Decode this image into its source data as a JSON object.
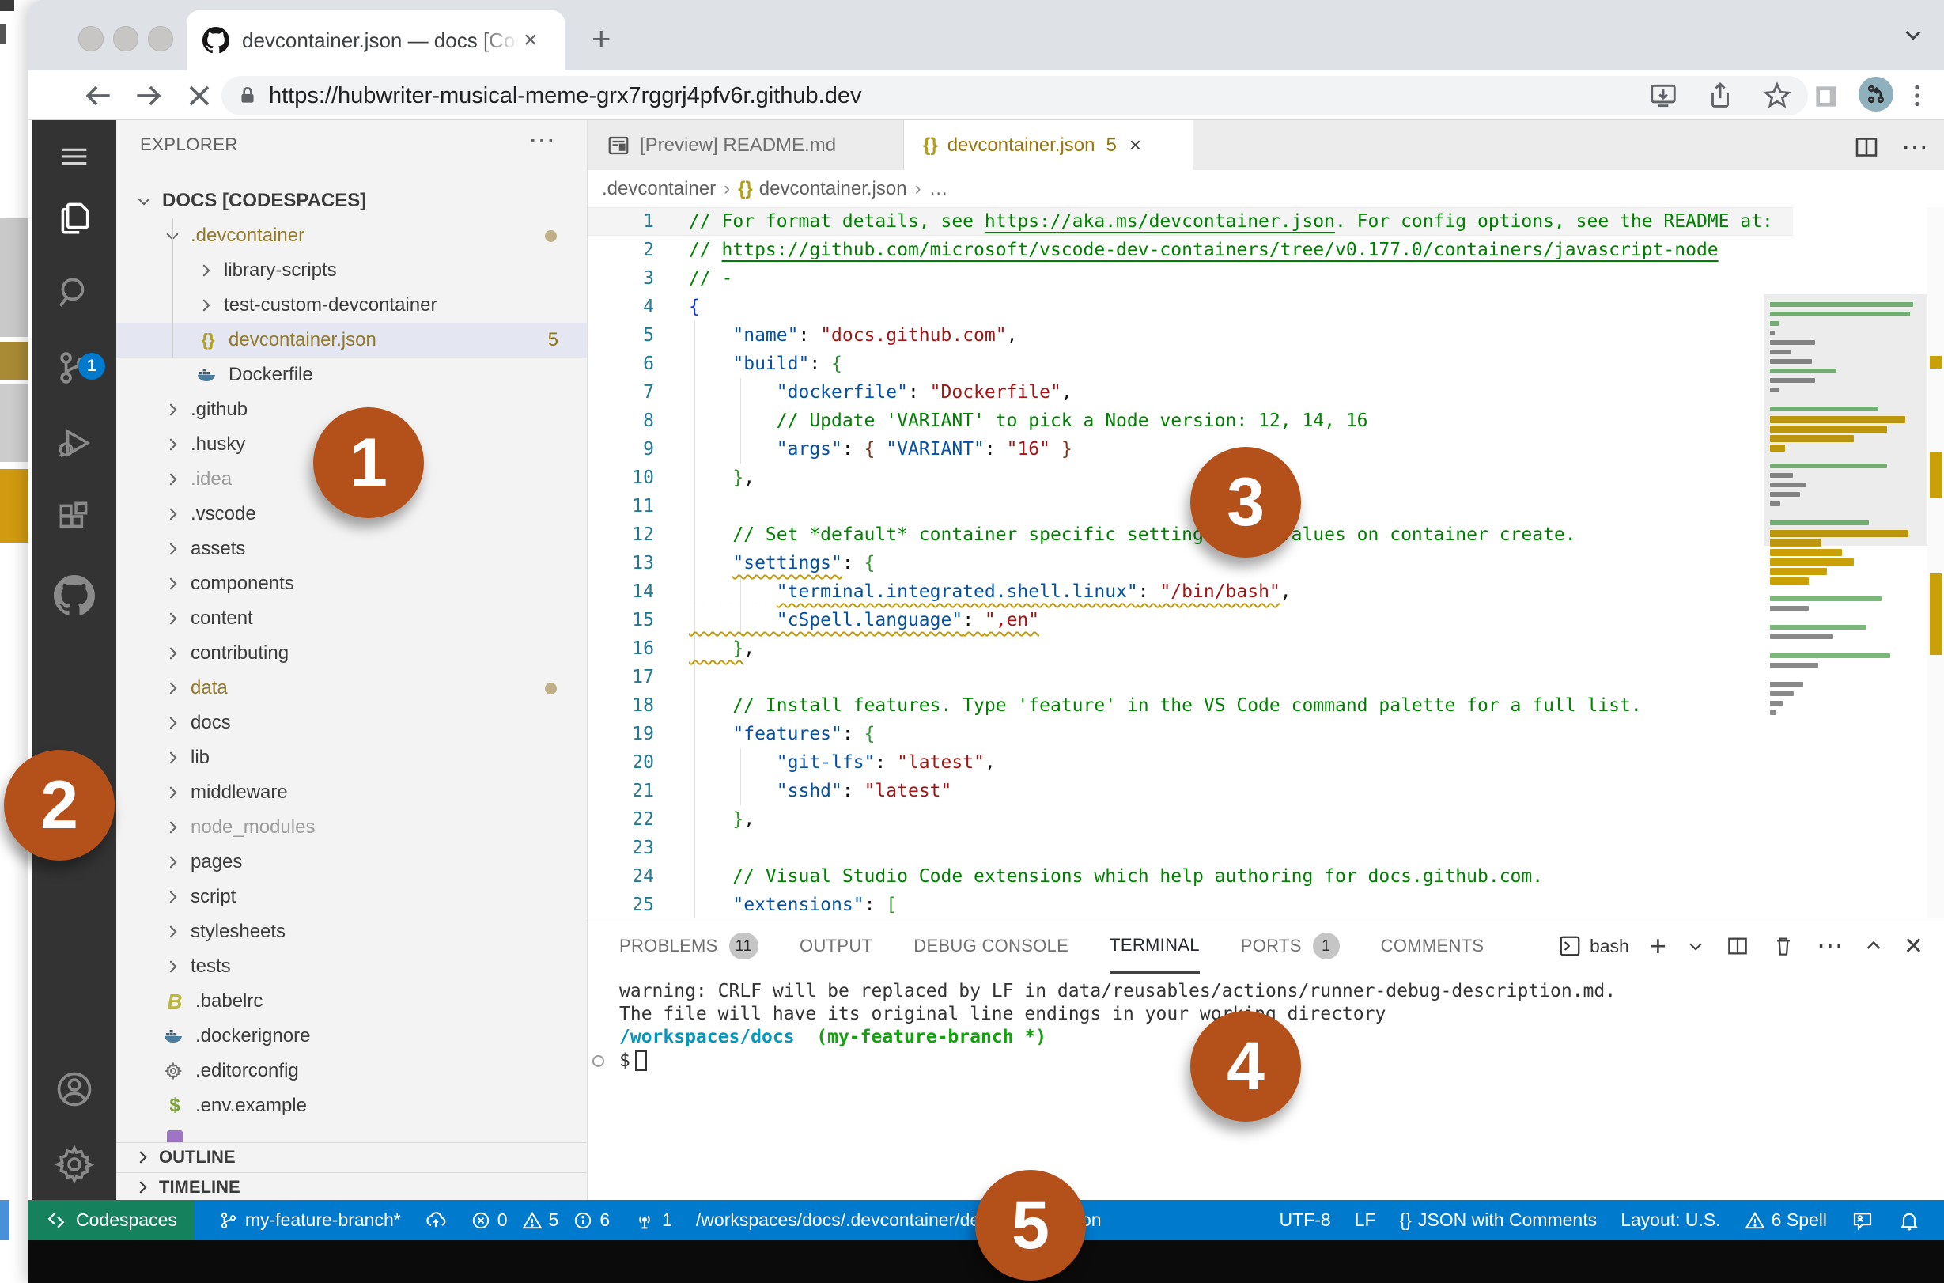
{
  "browser": {
    "tab_title": "devcontainer.json — docs [Cod",
    "tab_close": "×",
    "new_tab": "+",
    "url": "https://hubwriter-musical-meme-grx7rggrj4pfv6r.github.dev"
  },
  "activity_bar": {
    "scm_badge": "1",
    "items": [
      "menu",
      "explorer",
      "search",
      "source-control",
      "run-debug",
      "extensions",
      "github",
      "account",
      "settings"
    ]
  },
  "explorer": {
    "header": "EXPLORER",
    "header_actions": "⋯",
    "root_label": "DOCS [CODESPACES]",
    "items": [
      {
        "label": ".devcontainer",
        "depth": 1,
        "arrow": "down",
        "cls": "gold",
        "dot": true
      },
      {
        "label": "library-scripts",
        "depth": 2,
        "arrow": "right"
      },
      {
        "label": "test-custom-devcontainer",
        "depth": 2,
        "arrow": "right"
      },
      {
        "label": "devcontainer.json",
        "depth": 2,
        "icon": "json",
        "cls": "gold selected",
        "badge": "5"
      },
      {
        "label": "Dockerfile",
        "depth": 2,
        "icon": "docker"
      },
      {
        "label": ".github",
        "depth": 1,
        "arrow": "right"
      },
      {
        "label": ".husky",
        "depth": 1,
        "arrow": "right"
      },
      {
        "label": ".idea",
        "depth": 1,
        "arrow": "right",
        "cls": "ignored"
      },
      {
        "label": ".vscode",
        "depth": 1,
        "arrow": "right"
      },
      {
        "label": "assets",
        "depth": 1,
        "arrow": "right"
      },
      {
        "label": "components",
        "depth": 1,
        "arrow": "right"
      },
      {
        "label": "content",
        "depth": 1,
        "arrow": "right"
      },
      {
        "label": "contributing",
        "depth": 1,
        "arrow": "right"
      },
      {
        "label": "data",
        "depth": 1,
        "arrow": "right",
        "cls": "gold",
        "dot": true
      },
      {
        "label": "docs",
        "depth": 1,
        "arrow": "right"
      },
      {
        "label": "lib",
        "depth": 1,
        "arrow": "right"
      },
      {
        "label": "middleware",
        "depth": 1,
        "arrow": "right"
      },
      {
        "label": "node_modules",
        "depth": 1,
        "arrow": "right",
        "cls": "ignored"
      },
      {
        "label": "pages",
        "depth": 1,
        "arrow": "right"
      },
      {
        "label": "script",
        "depth": 1,
        "arrow": "right"
      },
      {
        "label": "stylesheets",
        "depth": 1,
        "arrow": "right"
      },
      {
        "label": "tests",
        "depth": 1,
        "arrow": "right"
      },
      {
        "label": ".babelrc",
        "depth": 1,
        "icon": "babel"
      },
      {
        "label": ".dockerignore",
        "depth": 1,
        "icon": "docker"
      },
      {
        "label": ".editorconfig",
        "depth": 1,
        "icon": "gear"
      },
      {
        "label": ".env.example",
        "depth": 1,
        "icon": "dollar"
      },
      {
        "label": "",
        "depth": 1,
        "icon": "purple"
      }
    ],
    "outline_label": "OUTLINE",
    "timeline_label": "TIMELINE"
  },
  "editor": {
    "tabs": [
      {
        "label": "[Preview] README.md",
        "active": false
      },
      {
        "label": "devcontainer.json",
        "badge": "5",
        "close": "×",
        "active": true
      }
    ],
    "breadcrumb": {
      "a": ".devcontainer",
      "b": "devcontainer.json",
      "c": "…",
      "json_icon": "{}"
    },
    "lines": [
      [
        {
          "c": "com",
          "t": "// For format details, see "
        },
        {
          "c": "com lnk",
          "t": "https://aka.ms/devcontainer.json"
        },
        {
          "c": "com",
          "t": ". For config options, see the README at:"
        }
      ],
      [
        {
          "c": "com",
          "t": "// "
        },
        {
          "c": "com lnk",
          "t": "https://github.com/microsoft/vscode-dev-containers/tree/v0.177.0/containers/javascript-node"
        }
      ],
      [
        {
          "c": "com",
          "t": "// -"
        }
      ],
      [
        {
          "c": "b1",
          "t": "{"
        }
      ],
      [
        {
          "t": "    "
        },
        {
          "c": "key",
          "t": "\"name\""
        },
        {
          "c": "pun",
          "t": ": "
        },
        {
          "c": "str",
          "t": "\"docs.github.com\""
        },
        {
          "c": "pun",
          "t": ","
        }
      ],
      [
        {
          "t": "    "
        },
        {
          "c": "key",
          "t": "\"build\""
        },
        {
          "c": "pun",
          "t": ": "
        },
        {
          "c": "b2",
          "t": "{"
        }
      ],
      [
        {
          "t": "        "
        },
        {
          "c": "key",
          "t": "\"dockerfile\""
        },
        {
          "c": "pun",
          "t": ": "
        },
        {
          "c": "str",
          "t": "\"Dockerfile\""
        },
        {
          "c": "pun",
          "t": ","
        }
      ],
      [
        {
          "t": "        "
        },
        {
          "c": "com",
          "t": "// Update 'VARIANT' to pick a Node version: 12, 14, 16"
        }
      ],
      [
        {
          "t": "        "
        },
        {
          "c": "key",
          "t": "\"args\""
        },
        {
          "c": "pun",
          "t": ": "
        },
        {
          "c": "b3",
          "t": "{ "
        },
        {
          "c": "key",
          "t": "\"VARIANT\""
        },
        {
          "c": "pun",
          "t": ": "
        },
        {
          "c": "str",
          "t": "\"16\""
        },
        {
          "c": "b3",
          "t": " }"
        }
      ],
      [
        {
          "t": "    "
        },
        {
          "c": "b2",
          "t": "}"
        },
        {
          "c": "pun",
          "t": ","
        }
      ],
      [],
      [
        {
          "t": "    "
        },
        {
          "c": "com",
          "t": "// Set *default* container specific settings.json values on container create."
        }
      ],
      [
        {
          "t": "    "
        },
        {
          "c": "key sq",
          "t": "\"settings\""
        },
        {
          "c": "pun",
          "t": ": "
        },
        {
          "c": "b2",
          "t": "{"
        }
      ],
      [
        {
          "c": "sq",
          "t": "        "
        },
        {
          "c": "key sq",
          "t": "\"terminal.integrated.shell.linux\""
        },
        {
          "c": "pun sq",
          "t": ": "
        },
        {
          "c": "str sq",
          "t": "\"/bin/bash\""
        },
        {
          "c": "pun",
          "t": ","
        }
      ],
      [
        {
          "c": "sq",
          "t": "        "
        },
        {
          "c": "key sq",
          "t": "\"cSpell.language\""
        },
        {
          "c": "pun sq",
          "t": ": "
        },
        {
          "c": "str sq",
          "t": "\",en\""
        }
      ],
      [
        {
          "c": "sq",
          "t": "    "
        },
        {
          "c": "b2 sq",
          "t": "}"
        },
        {
          "c": "pun",
          "t": ","
        }
      ],
      [],
      [
        {
          "t": "    "
        },
        {
          "c": "com",
          "t": "// Install features. Type 'feature' in the VS Code command palette for a full list."
        }
      ],
      [
        {
          "t": "    "
        },
        {
          "c": "key",
          "t": "\"features\""
        },
        {
          "c": "pun",
          "t": ": "
        },
        {
          "c": "b2",
          "t": "{"
        }
      ],
      [
        {
          "t": "        "
        },
        {
          "c": "key",
          "t": "\"git-lfs\""
        },
        {
          "c": "pun",
          "t": ": "
        },
        {
          "c": "str",
          "t": "\"latest\""
        },
        {
          "c": "pun",
          "t": ","
        }
      ],
      [
        {
          "t": "        "
        },
        {
          "c": "key",
          "t": "\"sshd\""
        },
        {
          "c": "pun",
          "t": ": "
        },
        {
          "c": "str",
          "t": "\"latest\""
        }
      ],
      [
        {
          "t": "    "
        },
        {
          "c": "b2",
          "t": "}"
        },
        {
          "c": "pun",
          "t": ","
        }
      ],
      [],
      [
        {
          "t": "    "
        },
        {
          "c": "com",
          "t": "// Visual Studio Code extensions which help authoring for docs.github.com."
        }
      ],
      [
        {
          "t": "    "
        },
        {
          "c": "key",
          "t": "\"extensions\""
        },
        {
          "c": "pun",
          "t": ": "
        },
        {
          "c": "b2",
          "t": "["
        }
      ]
    ],
    "minimap_rows": [
      [
        95,
        "g"
      ],
      [
        93,
        "g"
      ],
      [
        6,
        "g"
      ],
      [
        3,
        "d"
      ],
      [
        30,
        "d"
      ],
      [
        14,
        "d"
      ],
      [
        28,
        "d"
      ],
      [
        44,
        "g"
      ],
      [
        30,
        "d"
      ],
      [
        6,
        "d"
      ],
      [
        0,
        "d"
      ],
      [
        72,
        "g"
      ],
      [
        90,
        "o"
      ],
      [
        78,
        "o"
      ],
      [
        56,
        "o"
      ],
      [
        10,
        "o"
      ],
      [
        0,
        "d"
      ],
      [
        78,
        "g"
      ],
      [
        15,
        "d"
      ],
      [
        24,
        "d"
      ],
      [
        20,
        "d"
      ],
      [
        7,
        "d"
      ],
      [
        0,
        "d"
      ],
      [
        66,
        "g"
      ],
      [
        92,
        "o"
      ],
      [
        34,
        "o"
      ],
      [
        48,
        "o"
      ],
      [
        56,
        "o"
      ],
      [
        38,
        "o"
      ],
      [
        26,
        "o"
      ],
      [
        0,
        "d"
      ],
      [
        74,
        "g"
      ],
      [
        26,
        "d"
      ],
      [
        0,
        "d"
      ],
      [
        64,
        "g"
      ],
      [
        42,
        "d"
      ],
      [
        0,
        "d"
      ],
      [
        80,
        "g"
      ],
      [
        32,
        "d"
      ],
      [
        0,
        "d"
      ],
      [
        22,
        "d"
      ],
      [
        16,
        "d"
      ],
      [
        9,
        "d"
      ],
      [
        4,
        "d"
      ]
    ]
  },
  "panel": {
    "tabs": [
      {
        "label": "PROBLEMS",
        "badge": "11"
      },
      {
        "label": "OUTPUT"
      },
      {
        "label": "DEBUG CONSOLE"
      },
      {
        "label": "TERMINAL",
        "active": true
      },
      {
        "label": "PORTS",
        "badge": "1"
      },
      {
        "label": "COMMENTS"
      }
    ],
    "shell_label": "bash",
    "terminal_lines": [
      [
        {
          "t": "warning: CRLF will be replaced by LF in data/reusables/actions/runner-debug-description.md."
        }
      ],
      [
        {
          "t": "The file will have its original line endings in your working directory"
        }
      ],
      [
        {
          "c": "cwd",
          "t": "/workspaces/docs"
        },
        {
          "t": "  "
        },
        {
          "c": "branch",
          "t": "(my-feature-branch *)"
        }
      ]
    ],
    "prompt": "$"
  },
  "status_bar": {
    "remote_label": "Codespaces",
    "branch": "my-feature-branch*",
    "errors": "0",
    "warnings": "5",
    "infos": "6",
    "ports_count": "1",
    "path": "/workspaces/docs/.devcontainer/devcontainer.json",
    "encoding": "UTF-8",
    "eol": "LF",
    "lang_icon": "{}",
    "language": "JSON with Comments",
    "layout": "Layout: U.S.",
    "spell": "6 Spell"
  },
  "annotations": [
    "1",
    "2",
    "3",
    "4",
    "5"
  ],
  "colors": {
    "accent_blue": "#007acc",
    "remote_green": "#16825d",
    "annotation_orange": "#b4511b",
    "warning_gold": "#c09a0a",
    "modified_gold": "#937a2a"
  }
}
